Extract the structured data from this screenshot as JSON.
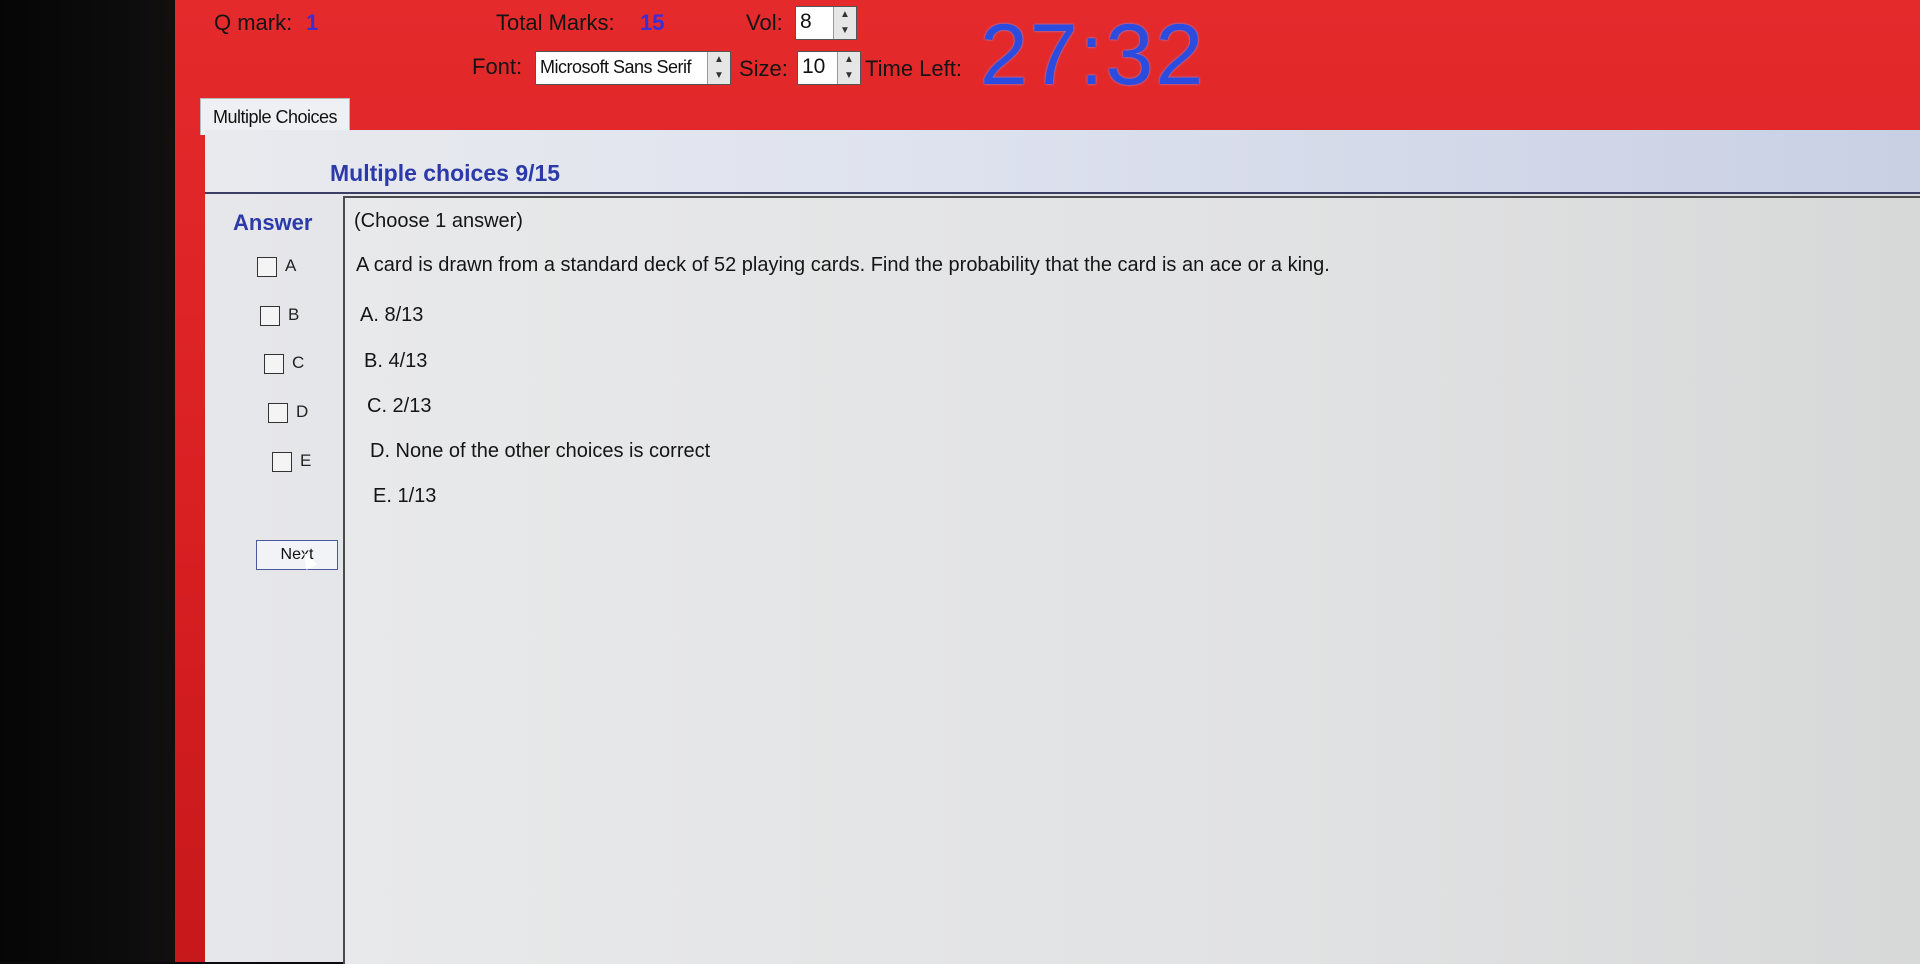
{
  "header": {
    "q_mark_label": "Q mark:",
    "q_mark_value": "1",
    "total_marks_label": "Total Marks:",
    "total_marks_value": "15",
    "vol_label": "Vol:",
    "vol_value": "8",
    "font_label": "Font:",
    "font_value": "Microsoft Sans Serif",
    "size_label": "Size:",
    "size_value": "10",
    "time_left_label": "Time Left:",
    "time_left_value": "27:32"
  },
  "tab": {
    "label": "Multiple Choices"
  },
  "section": {
    "title": "Multiple choices 9/15"
  },
  "answer": {
    "label": "Answer",
    "options": [
      {
        "label": "A",
        "checked": false
      },
      {
        "label": "B",
        "checked": false
      },
      {
        "label": "C",
        "checked": false
      },
      {
        "label": "D",
        "checked": false
      },
      {
        "label": "E",
        "checked": false
      }
    ],
    "next_label": "Next"
  },
  "question": {
    "instruction": "(Choose 1 answer)",
    "text": "A card is drawn from a standard deck of 52 playing cards. Find the probability that the card is an ace or a king.",
    "choices": [
      "A. 8/13",
      "B. 4/13",
      "C. 2/13",
      "D. None of the other choices is correct",
      "E. 1/13"
    ]
  }
}
